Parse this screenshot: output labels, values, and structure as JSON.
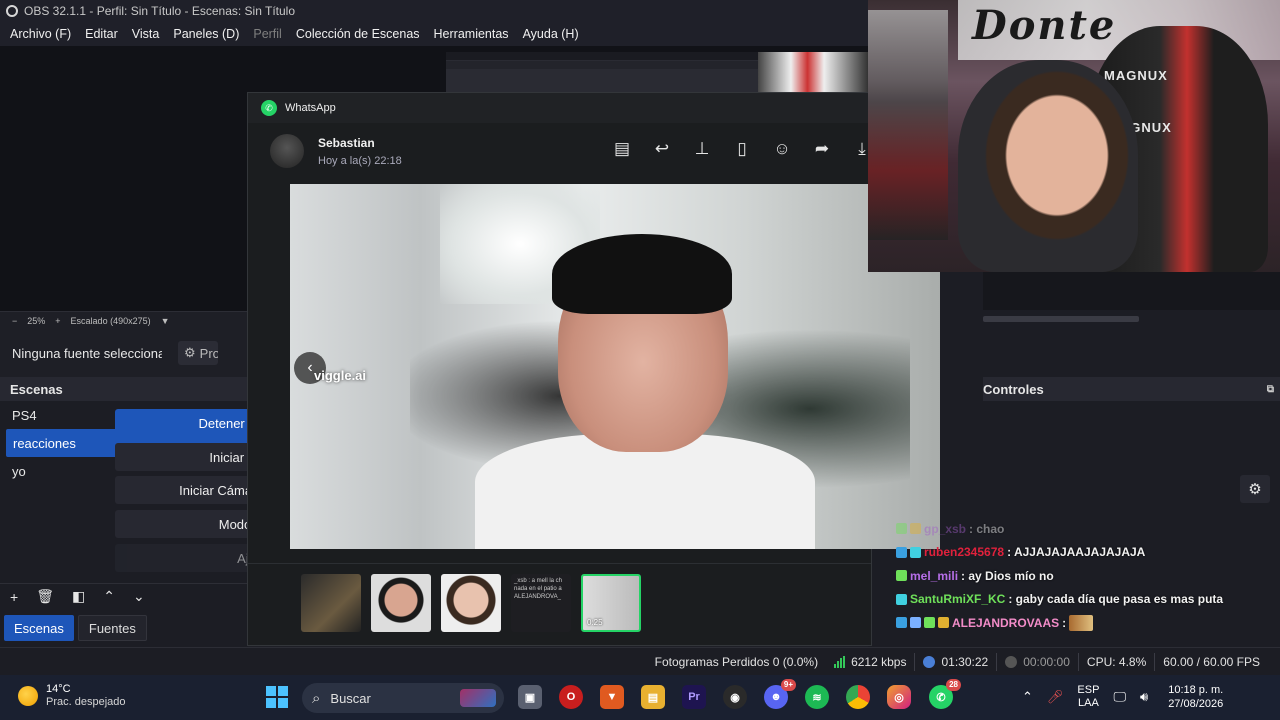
{
  "obs": {
    "title": "OBS 32.1.1 - Perfil: Sin Título - Escenas: Sin Título",
    "menu": [
      "Archivo (F)",
      "Editar",
      "Vista",
      "Paneles (D)",
      "Perfil",
      "Colección de Escenas",
      "Herramientas",
      "Ayuda (H)"
    ],
    "zoom": "25%",
    "scaling": "Escalado (490x275)",
    "no_source": "Ninguna fuente seleccionada",
    "properties_label": "Propiedades",
    "scenes_title": "Escenas",
    "scenes": [
      {
        "name": "PS4",
        "selected": false
      },
      {
        "name": "reacciones",
        "selected": true
      },
      {
        "name": "yo",
        "selected": false
      }
    ],
    "tabs": {
      "scenes": "Escenas",
      "sources": "Fuentes"
    },
    "controls": {
      "title": "Controles",
      "stop_stream": "Detener Transmisión",
      "start_recording": "Iniciar Grabación",
      "start_virtualcam": "Iniciar Cámara Virtual",
      "studio_mode": "Modo Estudio",
      "settings": "Ajustes"
    },
    "status": {
      "dropped_frames": "Fotogramas Perdidos 0 (0.0%)",
      "bitrate": "6212 kbps",
      "stream_time": "01:30:22",
      "record_time": "00:00:00",
      "cpu": "CPU: 4.8%",
      "fps": "60.00 / 60.00 FPS"
    },
    "accent": "#1e56b9"
  },
  "whatsapp": {
    "app_title": "WhatsApp",
    "contact_name": "Sebastian",
    "timestamp": "Hoy a la(s) 22:18",
    "media_watermark": "viggle.ai",
    "video_duration": "0:25",
    "thumb_text": "_xsb : a mell la ch nada en el patio a ALEJANDROVA_",
    "accent": "#25d366"
  },
  "webcam": {
    "graffiti": "Donte",
    "chair_brand": "MAGNUX"
  },
  "chat": [
    {
      "user": "gp_xsb",
      "msg": ": chao",
      "color": "#a05cc7",
      "faded": true
    },
    {
      "user": "ruben2345678",
      "msg": ": AJJAJAJAAJAJAJAJA",
      "color": "#e0213c",
      "faded": false
    },
    {
      "user": "mel_mili",
      "msg": ": ay Dios mío no",
      "color": "#b66ee8",
      "faded": false
    },
    {
      "user": "SantuRmiXF_KC",
      "msg": ": gaby cada día que pasa es mas puta",
      "color": "#6fe05a",
      "faded": false
    },
    {
      "user": "ALEJANDROVAAS",
      "msg": ":",
      "color": "#f28cc8",
      "faded": false
    }
  ],
  "taskbar": {
    "temperature": "14°C",
    "weather": "Prac. despejado",
    "search_placeholder": "Buscar",
    "lang_top": "ESP",
    "lang_bottom": "LAA",
    "time": "10:18 p. m.",
    "date": "27/08/2026",
    "discord_badge": "9+",
    "whatsapp_badge": "28"
  }
}
